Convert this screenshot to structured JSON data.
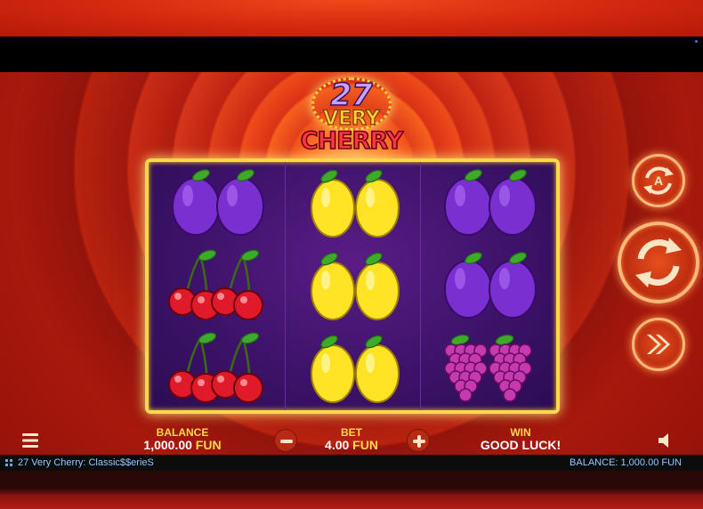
{
  "game": {
    "logo": {
      "number": "27",
      "line1": "VERY",
      "line2": "CHERRY"
    },
    "reels": [
      [
        "plum",
        "cherry",
        "cherry"
      ],
      [
        "lemon",
        "lemon",
        "lemon"
      ],
      [
        "plum",
        "plum",
        "grapes"
      ]
    ],
    "controls": {
      "autoplay_icon": "autoplay-icon",
      "spin_icon": "spin-icon",
      "turbo_icon": "fast-forward-icon"
    }
  },
  "hud": {
    "balance_label": "BALANCE",
    "balance_value": "1,000.00",
    "balance_currency": "FUN",
    "bet_label": "BET",
    "bet_value": "4.00",
    "bet_currency": "FUN",
    "win_label": "WIN",
    "win_value": "GOOD LUCK!",
    "menu_icon": "hamburger-menu-icon",
    "sound_icon": "speaker-icon",
    "minus_icon": "minus-icon",
    "plus_icon": "plus-icon"
  },
  "status": {
    "title": "27 Very Cherry: Classic$$erieS",
    "balance": "BALANCE: 1,000.00 FUN"
  },
  "colors": {
    "accent_gold": "#ffd84a",
    "reel_bg": "#3d136a",
    "stage_red": "#d5361a"
  }
}
